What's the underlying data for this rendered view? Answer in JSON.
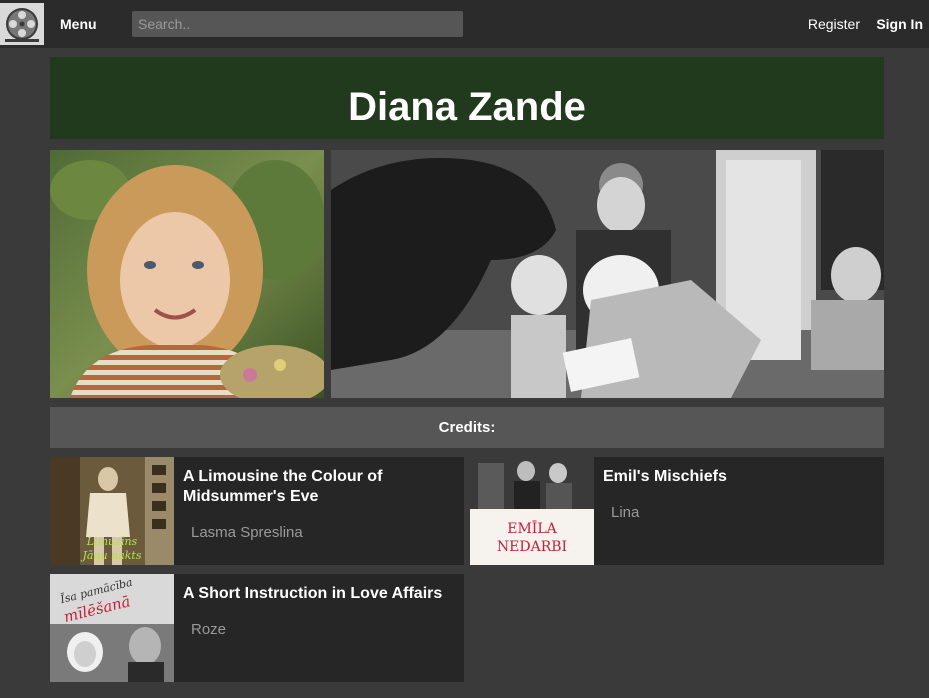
{
  "nav": {
    "logo_icon": "film-reel-icon",
    "menu_label": "Menu",
    "search_placeholder": "Search..",
    "register_label": "Register",
    "signin_label": "Sign In"
  },
  "person": {
    "name": "Diana Zande"
  },
  "credits": {
    "heading": "Credits:",
    "items": [
      {
        "title": "A Limousine the Colour of Midsummer's Eve",
        "role": "Lasma Spreslina",
        "poster_text": "Limuzīns Jāņu nakts"
      },
      {
        "title": "Emil's Mischiefs",
        "role": "Lina",
        "poster_text": "EMĪLA NEDARBI"
      },
      {
        "title": "A Short Instruction in Love Affairs",
        "role": "Roze",
        "poster_text": "Īsa pamācība mīlēšanā"
      }
    ]
  }
}
